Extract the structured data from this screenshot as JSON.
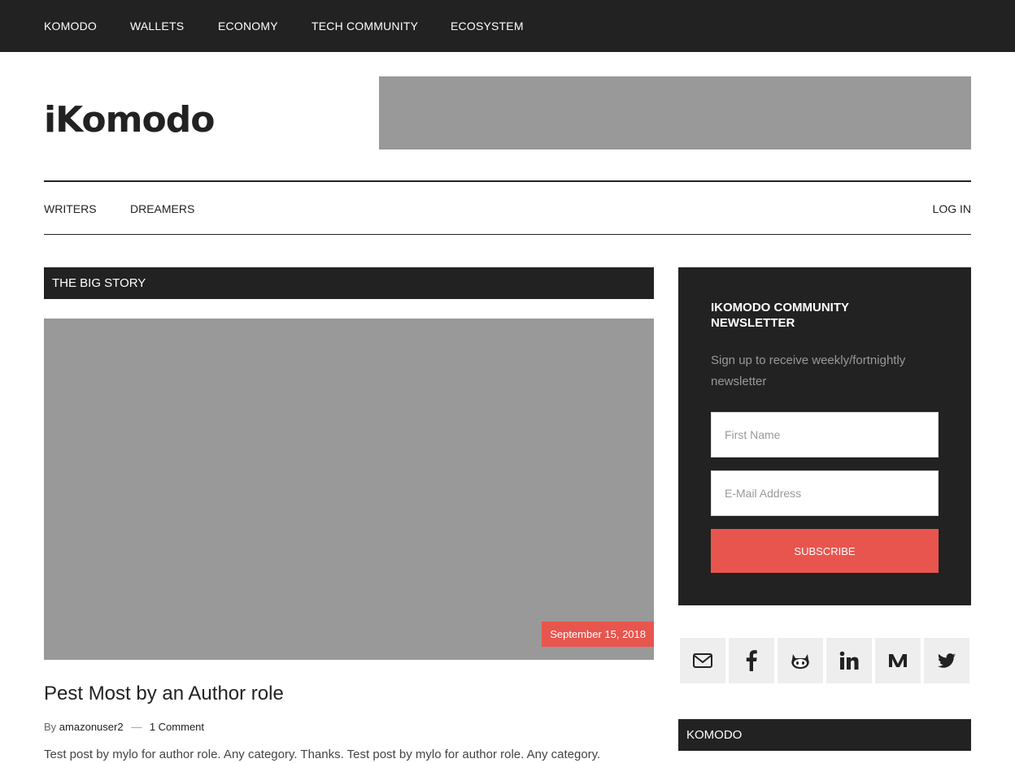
{
  "top_nav": {
    "items": [
      {
        "label": "KOMODO"
      },
      {
        "label": "WALLETS"
      },
      {
        "label": "ECONOMY"
      },
      {
        "label": "TECH COMMUNITY"
      },
      {
        "label": "ECOSYSTEM"
      }
    ]
  },
  "header": {
    "site_title": "iKomodo"
  },
  "secondary_nav": {
    "items": [
      {
        "label": "WRITERS"
      },
      {
        "label": "DREAMERS"
      }
    ],
    "login_label": "LOG IN"
  },
  "main": {
    "section_title": "THE BIG STORY",
    "post": {
      "date": "September 15, 2018",
      "title": "Pest Most by an Author role",
      "meta_by": "By",
      "author": "amazonuser2",
      "meta_separator": "—",
      "comments": "1 Comment",
      "excerpt": "Test post by mylo for author role.  Any category.  Thanks. Test post by mylo for author role.  Any category."
    }
  },
  "sidebar": {
    "newsletter": {
      "title": "IKOMODO COMMUNITY NEWSLETTER",
      "description": "Sign up to receive weekly/fortnightly newsletter",
      "first_name_placeholder": "First Name",
      "email_placeholder": "E-Mail Address",
      "submit_label": "SUBSCRIBE"
    },
    "social_icons": [
      "email-icon",
      "facebook-icon",
      "github-icon",
      "linkedin-icon",
      "medium-icon",
      "twitter-icon"
    ],
    "widget_title": "KOMODO"
  },
  "colors": {
    "dark": "#222222",
    "accent": "#e8554e",
    "placeholder_gray": "#999999",
    "icon_bg": "#eeeeee"
  }
}
